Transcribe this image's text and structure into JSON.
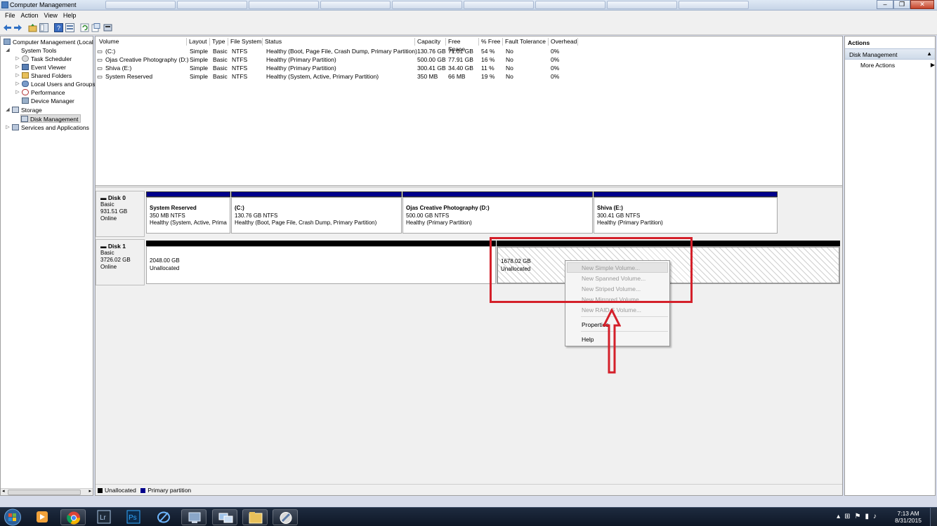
{
  "window": {
    "title": "Computer Management"
  },
  "menu": [
    "File",
    "Action",
    "View",
    "Help"
  ],
  "tree": {
    "root": "Computer Management (Local",
    "system_tools": "System Tools",
    "task_scheduler": "Task Scheduler",
    "event_viewer": "Event Viewer",
    "shared_folders": "Shared Folders",
    "local_users": "Local Users and Groups",
    "performance": "Performance",
    "device_manager": "Device Manager",
    "storage": "Storage",
    "disk_management": "Disk Management",
    "services": "Services and Applications"
  },
  "volume_table": {
    "columns": [
      "Volume",
      "Layout",
      "Type",
      "File System",
      "Status",
      "Capacity",
      "Free Space",
      "% Free",
      "Fault Tolerance",
      "Overhead"
    ],
    "rows": [
      [
        "(C:)",
        "Simple",
        "Basic",
        "NTFS",
        "Healthy (Boot, Page File, Crash Dump, Primary Partition)",
        "130.76 GB",
        "71.01 GB",
        "54 %",
        "No",
        "0%"
      ],
      [
        "Ojas Creative Photography (D:)",
        "Simple",
        "Basic",
        "NTFS",
        "Healthy (Primary Partition)",
        "500.00 GB",
        "77.91 GB",
        "16 %",
        "No",
        "0%"
      ],
      [
        "Shiva (E:)",
        "Simple",
        "Basic",
        "NTFS",
        "Healthy (Primary Partition)",
        "300.41 GB",
        "34.40 GB",
        "11 %",
        "No",
        "0%"
      ],
      [
        "System Reserved",
        "Simple",
        "Basic",
        "NTFS",
        "Healthy (System, Active, Primary Partition)",
        "350 MB",
        "66 MB",
        "19 %",
        "No",
        "0%"
      ]
    ]
  },
  "disk0": {
    "name": "Disk 0",
    "type": "Basic",
    "size": "931.51 GB",
    "status": "Online",
    "partitions": [
      {
        "name": "System Reserved",
        "size": "350 MB NTFS",
        "status": "Healthy (System, Active, Prima"
      },
      {
        "name": "(C:)",
        "size": "130.76 GB NTFS",
        "status": "Healthy (Boot, Page File, Crash Dump, Primary Partition)"
      },
      {
        "name": "Ojas Creative Photography  (D:)",
        "size": "500.00 GB NTFS",
        "status": "Healthy (Primary Partition)"
      },
      {
        "name": "Shiva  (E:)",
        "size": "300.41 GB NTFS",
        "status": "Healthy (Primary Partition)"
      }
    ]
  },
  "disk1": {
    "name": "Disk 1",
    "type": "Basic",
    "size": "3726.02 GB",
    "status": "Online",
    "partitions": [
      {
        "size": "2048.00 GB",
        "status": "Unallocated"
      },
      {
        "size": "1678.02 GB",
        "status": "Unallocated"
      }
    ]
  },
  "legend": {
    "unallocated": "Unallocated",
    "primary": "Primary partition"
  },
  "actions": {
    "header": "Actions",
    "section": "Disk Management",
    "more": "More Actions"
  },
  "context_menu": {
    "new_simple": "New Simple Volume...",
    "new_spanned": "New Spanned Volume...",
    "new_striped": "New Striped Volume...",
    "new_mirrored": "New Mirrored Volume...",
    "new_raid5": "New RAID-5 Volume...",
    "properties": "Properties",
    "help": "Help"
  },
  "taskbar": {
    "time": "7:13 AM",
    "date": "8/31/2015"
  },
  "colors": {
    "primary_partition": "#00008b",
    "unallocated": "#000000",
    "annotation": "#d4202a"
  }
}
